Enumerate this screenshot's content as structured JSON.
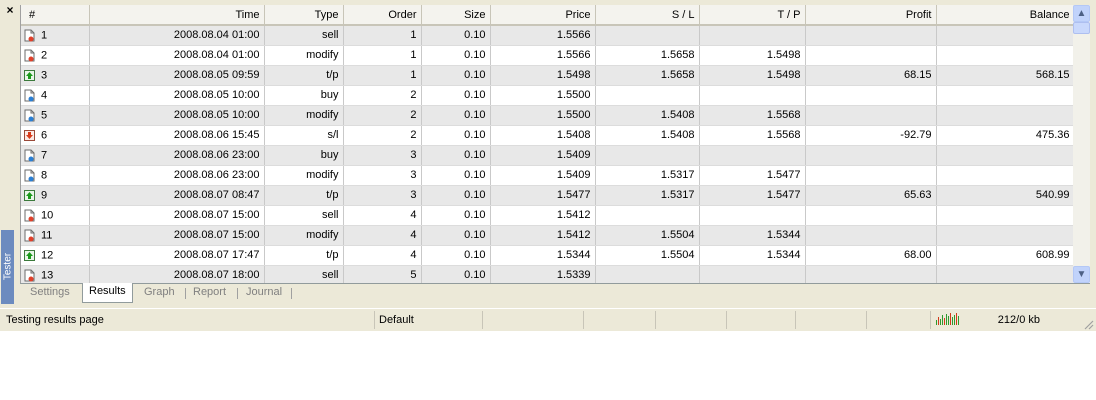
{
  "panel": {
    "close_glyph": "×",
    "side_title": "Tester"
  },
  "columns": {
    "num": "#",
    "time": "Time",
    "type": "Type",
    "order": "Order",
    "size": "Size",
    "price": "Price",
    "sl": "S / L",
    "tp": "T / P",
    "profit": "Profit",
    "balance": "Balance"
  },
  "rows": [
    {
      "num": "1",
      "icon": "sell-order-icon",
      "time": "2008.08.04 01:00",
      "type": "sell",
      "order": "1",
      "size": "0.10",
      "price": "1.5566",
      "sl": "",
      "tp": "",
      "profit": "",
      "balance": ""
    },
    {
      "num": "2",
      "icon": "sell-order-icon",
      "time": "2008.08.04 01:00",
      "type": "modify",
      "order": "1",
      "size": "0.10",
      "price": "1.5566",
      "sl": "1.5658",
      "tp": "1.5498",
      "profit": "",
      "balance": ""
    },
    {
      "num": "3",
      "icon": "take-profit-icon",
      "time": "2008.08.05 09:59",
      "type": "t/p",
      "order": "1",
      "size": "0.10",
      "price": "1.5498",
      "sl": "1.5658",
      "tp": "1.5498",
      "profit": "68.15",
      "balance": "568.15"
    },
    {
      "num": "4",
      "icon": "buy-order-icon",
      "time": "2008.08.05 10:00",
      "type": "buy",
      "order": "2",
      "size": "0.10",
      "price": "1.5500",
      "sl": "",
      "tp": "",
      "profit": "",
      "balance": ""
    },
    {
      "num": "5",
      "icon": "buy-order-icon",
      "time": "2008.08.05 10:00",
      "type": "modify",
      "order": "2",
      "size": "0.10",
      "price": "1.5500",
      "sl": "1.5408",
      "tp": "1.5568",
      "profit": "",
      "balance": ""
    },
    {
      "num": "6",
      "icon": "stop-loss-icon",
      "time": "2008.08.06 15:45",
      "type": "s/l",
      "order": "2",
      "size": "0.10",
      "price": "1.5408",
      "sl": "1.5408",
      "tp": "1.5568",
      "profit": "-92.79",
      "balance": "475.36"
    },
    {
      "num": "7",
      "icon": "buy-order-icon",
      "time": "2008.08.06 23:00",
      "type": "buy",
      "order": "3",
      "size": "0.10",
      "price": "1.5409",
      "sl": "",
      "tp": "",
      "profit": "",
      "balance": ""
    },
    {
      "num": "8",
      "icon": "buy-order-icon",
      "time": "2008.08.06 23:00",
      "type": "modify",
      "order": "3",
      "size": "0.10",
      "price": "1.5409",
      "sl": "1.5317",
      "tp": "1.5477",
      "profit": "",
      "balance": ""
    },
    {
      "num": "9",
      "icon": "take-profit-icon",
      "time": "2008.08.07 08:47",
      "type": "t/p",
      "order": "3",
      "size": "0.10",
      "price": "1.5477",
      "sl": "1.5317",
      "tp": "1.5477",
      "profit": "65.63",
      "balance": "540.99"
    },
    {
      "num": "10",
      "icon": "sell-order-icon",
      "time": "2008.08.07 15:00",
      "type": "sell",
      "order": "4",
      "size": "0.10",
      "price": "1.5412",
      "sl": "",
      "tp": "",
      "profit": "",
      "balance": ""
    },
    {
      "num": "11",
      "icon": "sell-order-icon",
      "time": "2008.08.07 15:00",
      "type": "modify",
      "order": "4",
      "size": "0.10",
      "price": "1.5412",
      "sl": "1.5504",
      "tp": "1.5344",
      "profit": "",
      "balance": ""
    },
    {
      "num": "12",
      "icon": "take-profit-icon",
      "time": "2008.08.07 17:47",
      "type": "t/p",
      "order": "4",
      "size": "0.10",
      "price": "1.5344",
      "sl": "1.5504",
      "tp": "1.5344",
      "profit": "68.00",
      "balance": "608.99"
    },
    {
      "num": "13",
      "icon": "sell-order-icon",
      "time": "2008.08.07 18:00",
      "type": "sell",
      "order": "5",
      "size": "0.10",
      "price": "1.5339",
      "sl": "",
      "tp": "",
      "profit": "",
      "balance": ""
    }
  ],
  "tabs": [
    {
      "label": "Settings",
      "active": false
    },
    {
      "label": "Results",
      "active": true
    },
    {
      "label": "Graph",
      "active": false
    },
    {
      "label": "Report",
      "active": false
    },
    {
      "label": "Journal",
      "active": false
    }
  ],
  "status": {
    "message": "Testing results page",
    "profile": "Default",
    "traffic": "212/0 kb",
    "connection_icon": "connection-bars-icon"
  },
  "scrollbar": {
    "up_glyph": "▲",
    "down_glyph": "▼"
  },
  "colors": {
    "sell_dot": "#e0402a",
    "buy_dot": "#2a7fd4",
    "tp_arrow": "#1a9a1a",
    "sl_arrow": "#d83a1a",
    "side_title_bg": "#6c8bbf"
  }
}
